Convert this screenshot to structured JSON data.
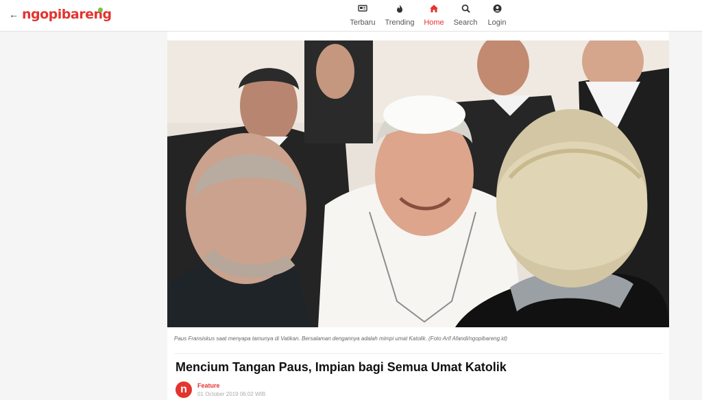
{
  "header": {
    "back_icon": "arrow-left-icon",
    "logo_text": "ngopibareng",
    "brand_color": "#e3342f",
    "dot_color": "#7ac142"
  },
  "nav": {
    "items": [
      {
        "label": "Terbaru",
        "icon": "newspaper-icon"
      },
      {
        "label": "Trending",
        "icon": "flame-icon"
      },
      {
        "label": "Home",
        "icon": "home-icon",
        "active": true
      },
      {
        "label": "Search",
        "icon": "search-icon"
      },
      {
        "label": "Login",
        "icon": "user-icon"
      }
    ]
  },
  "article": {
    "hero_image_description": "photo",
    "caption": "Paus Fransiskus saat menyapa tamunya di Vatikan. Bersalaman dengannya adalah mimpi umat Katolik. (Foto Arif Afandi/ngopibareng.id)",
    "title": "Mencium Tangan Paus, Impian bagi Semua Umat Katolik",
    "author_avatar_letter": "n",
    "category": "Feature",
    "date": "01 October 2019 06:02 WIB"
  }
}
